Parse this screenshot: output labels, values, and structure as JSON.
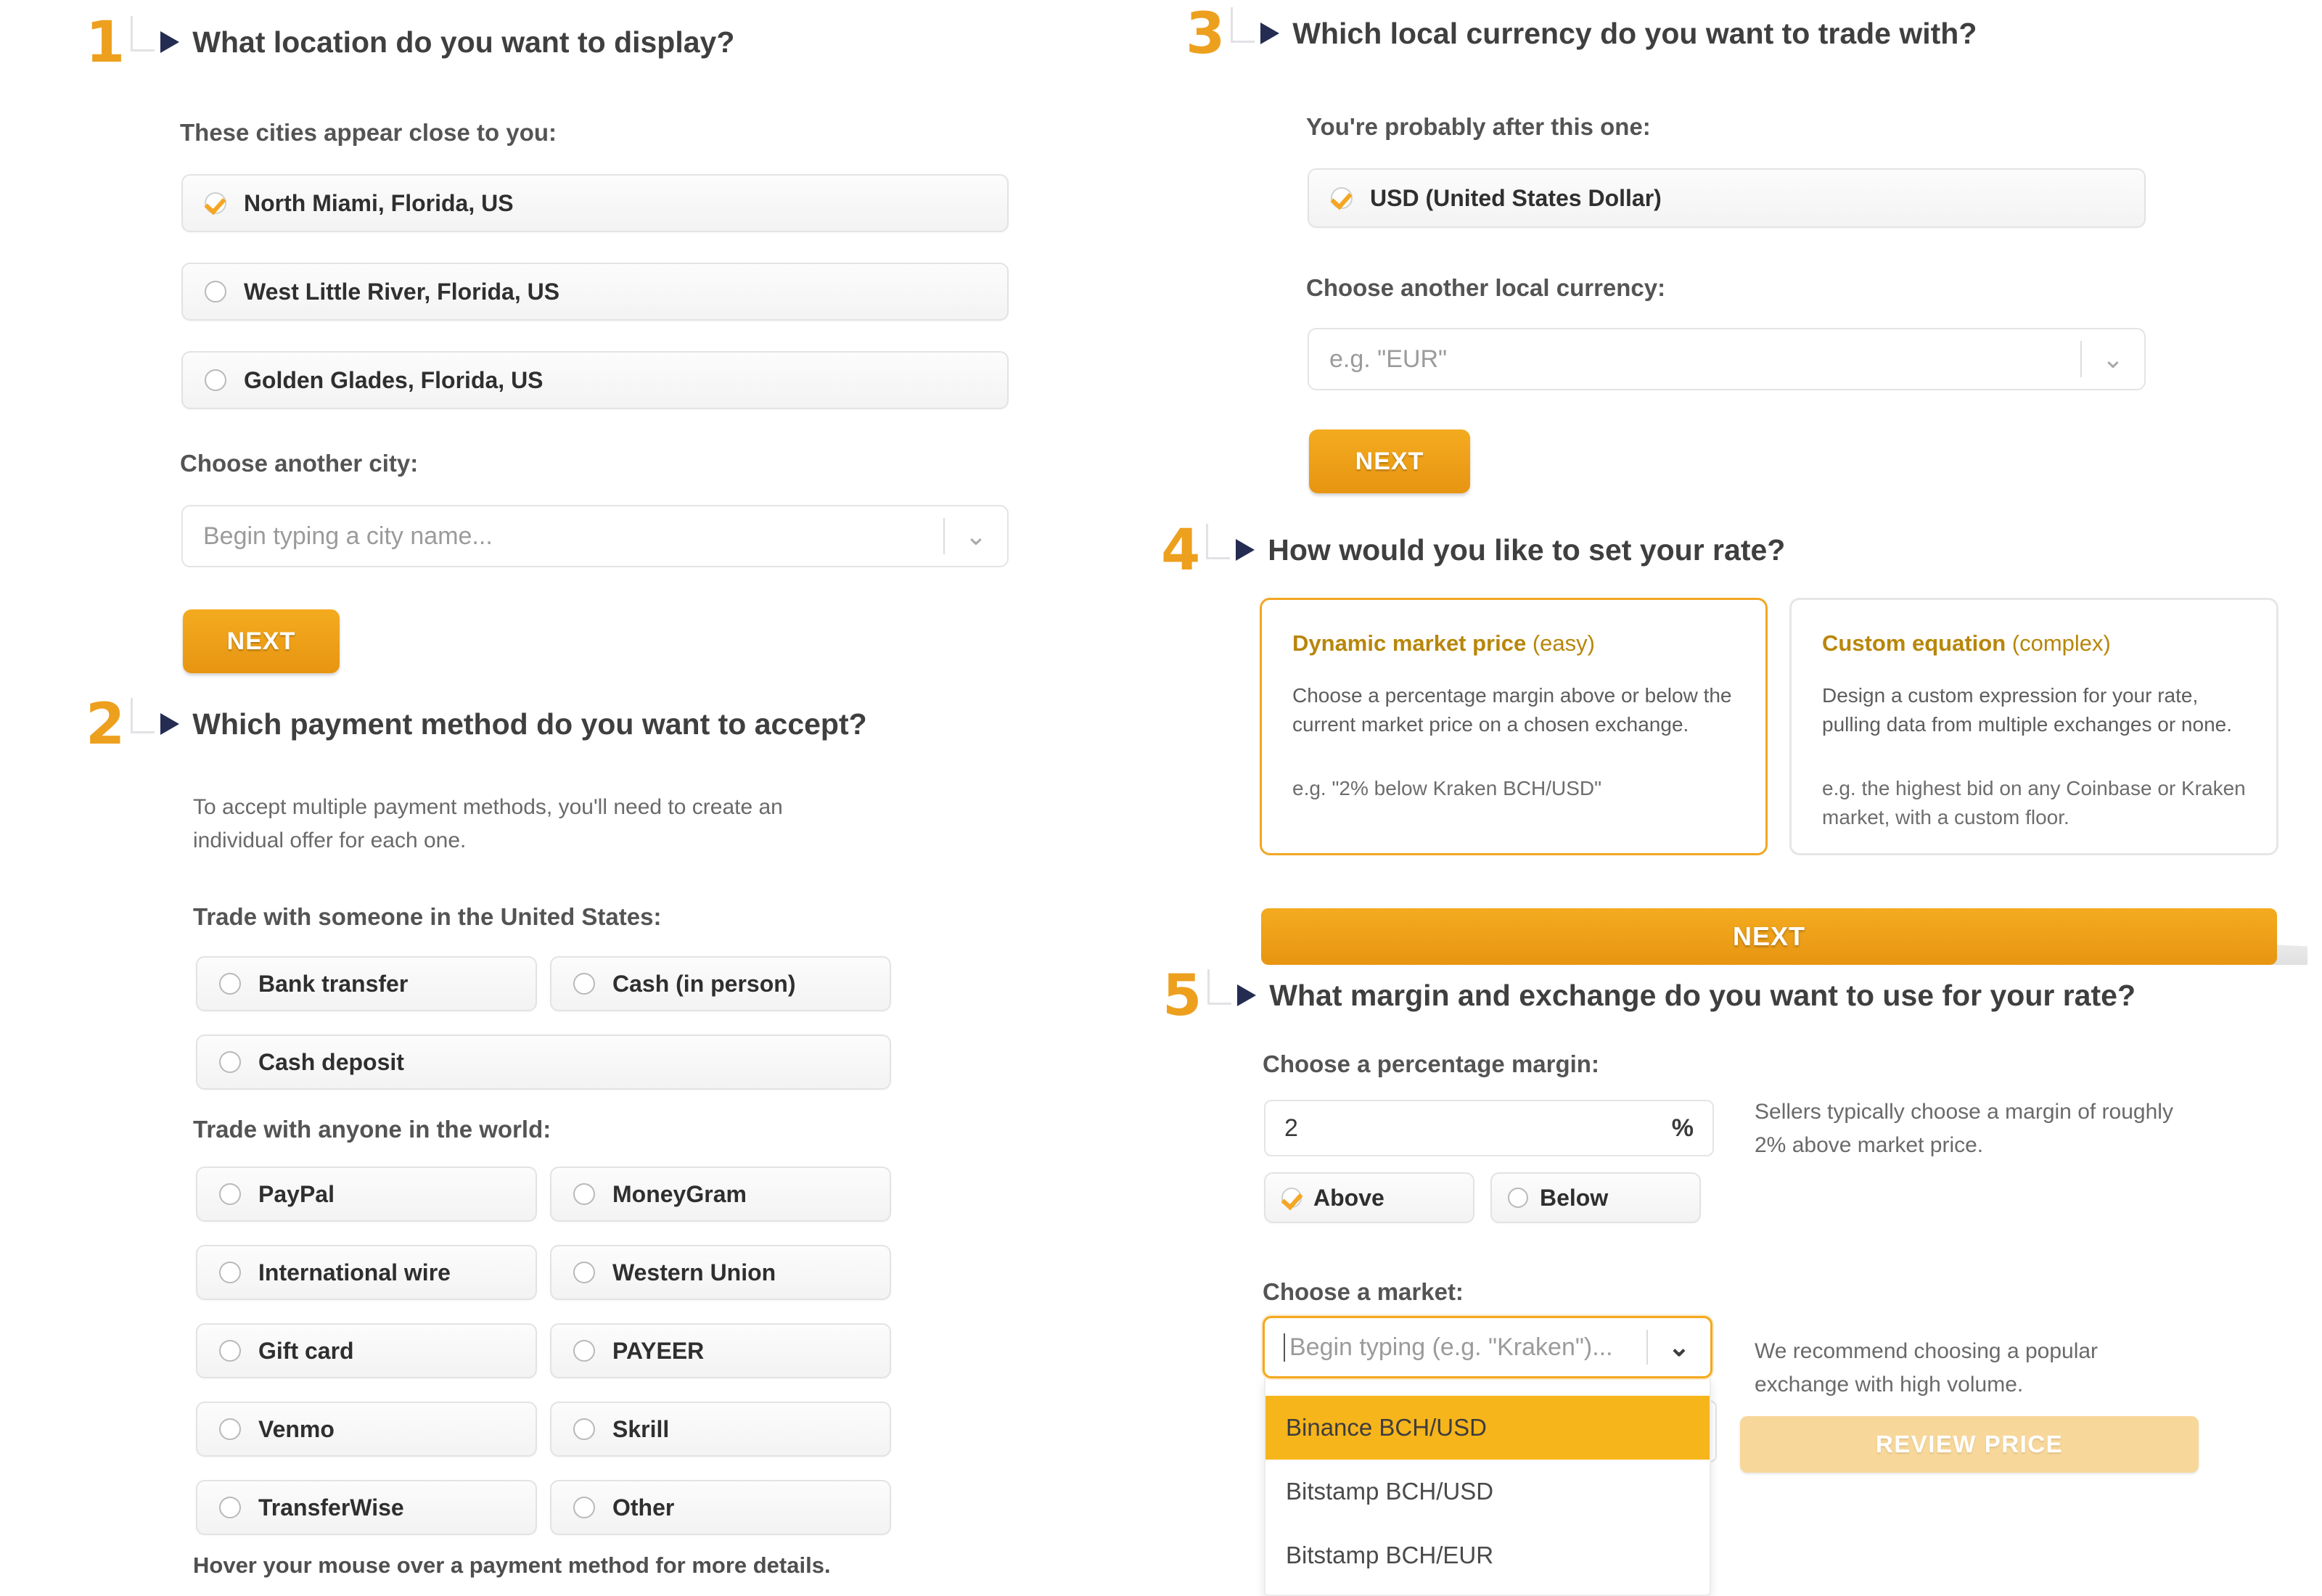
{
  "colors": {
    "accent_orange": "#eda01e",
    "button_orange": "#f4ab1f",
    "card_title_gold": "#b8860b",
    "highlight_yellow": "#f7b51c",
    "arrow_navy": "#242c52",
    "review_disabled": "#f7d79a"
  },
  "steps": {
    "one": {
      "number": "1",
      "title": "What location do you want to display?",
      "cities_label": "These cities appear close to you:",
      "cities": [
        {
          "label": "North Miami, Florida, US",
          "checked": true
        },
        {
          "label": "West Little River, Florida, US",
          "checked": false
        },
        {
          "label": "Golden Glades, Florida, US",
          "checked": false
        }
      ],
      "another_city_label": "Choose another city:",
      "city_placeholder": "Begin typing a city name...",
      "next_label": "NEXT"
    },
    "two": {
      "number": "2",
      "title": "Which payment method do you want to accept?",
      "note_line1": "To accept multiple payment methods, you'll need to create an",
      "note_line2": "individual offer for each one.",
      "local_label": "Trade with someone in the United States:",
      "local_methods": [
        {
          "label": "Bank transfer",
          "checked": false
        },
        {
          "label": "Cash (in person)",
          "checked": false
        },
        {
          "label": "Cash deposit",
          "checked": false
        }
      ],
      "world_label": "Trade with anyone in the world:",
      "world_methods": [
        {
          "label": "PayPal",
          "checked": false
        },
        {
          "label": "MoneyGram",
          "checked": false
        },
        {
          "label": "International wire",
          "checked": false
        },
        {
          "label": "Western Union",
          "checked": false
        },
        {
          "label": "Gift card",
          "checked": false
        },
        {
          "label": "PAYEER",
          "checked": false
        },
        {
          "label": "Venmo",
          "checked": false
        },
        {
          "label": "Skrill",
          "checked": false
        },
        {
          "label": "TransferWise",
          "checked": false
        },
        {
          "label": "Other",
          "checked": false
        }
      ],
      "hover_hint": "Hover your mouse over a payment method for more details."
    },
    "three": {
      "number": "3",
      "title": "Which local currency do you want to trade with?",
      "suggestion_label": "You're probably after this one:",
      "suggested_currency": {
        "label": "USD (United States Dollar)",
        "checked": true
      },
      "another_currency_label": "Choose another local currency:",
      "currency_placeholder": "e.g. \"EUR\"",
      "next_label": "NEXT"
    },
    "four": {
      "number": "4",
      "title": "How would you like to set your rate?",
      "cards": [
        {
          "title_bold": "Dynamic market price",
          "title_light": " (easy)",
          "description": "Choose a percentage margin above or below the current market price on a chosen exchange.",
          "example": "e.g. \"2% below Kraken BCH/USD\"",
          "selected": true
        },
        {
          "title_bold": "Custom equation",
          "title_light": " (complex)",
          "description": "Design a custom expression for your rate, pulling data from multiple exchanges or none.",
          "example": "e.g. the highest bid on any Coinbase or Kraken market, with a custom floor.",
          "selected": false
        }
      ],
      "next_label": "NEXT"
    },
    "five": {
      "number": "5",
      "title": "What margin and exchange do you want to use for your rate?",
      "margin_label": "Choose a percentage margin:",
      "margin_value": "2",
      "margin_unit": "%",
      "margin_hint_line1": "Sellers typically choose a margin of roughly",
      "margin_hint_line2": "2% above market price.",
      "direction_options": [
        {
          "label": "Above",
          "checked": true
        },
        {
          "label": "Below",
          "checked": false
        }
      ],
      "market_label": "Choose a market:",
      "market_placeholder": "Begin typing (e.g. \"Kraken\")...",
      "market_hint_line1": "We recommend choosing a popular",
      "market_hint_line2": "exchange with high volume.",
      "market_options": [
        {
          "label": "Binance BCH/USD",
          "active": true
        },
        {
          "label": "Bitstamp BCH/USD",
          "active": false
        },
        {
          "label": "Bitstamp BCH/EUR",
          "active": false
        }
      ],
      "review_label": "REVIEW PRICE"
    }
  }
}
